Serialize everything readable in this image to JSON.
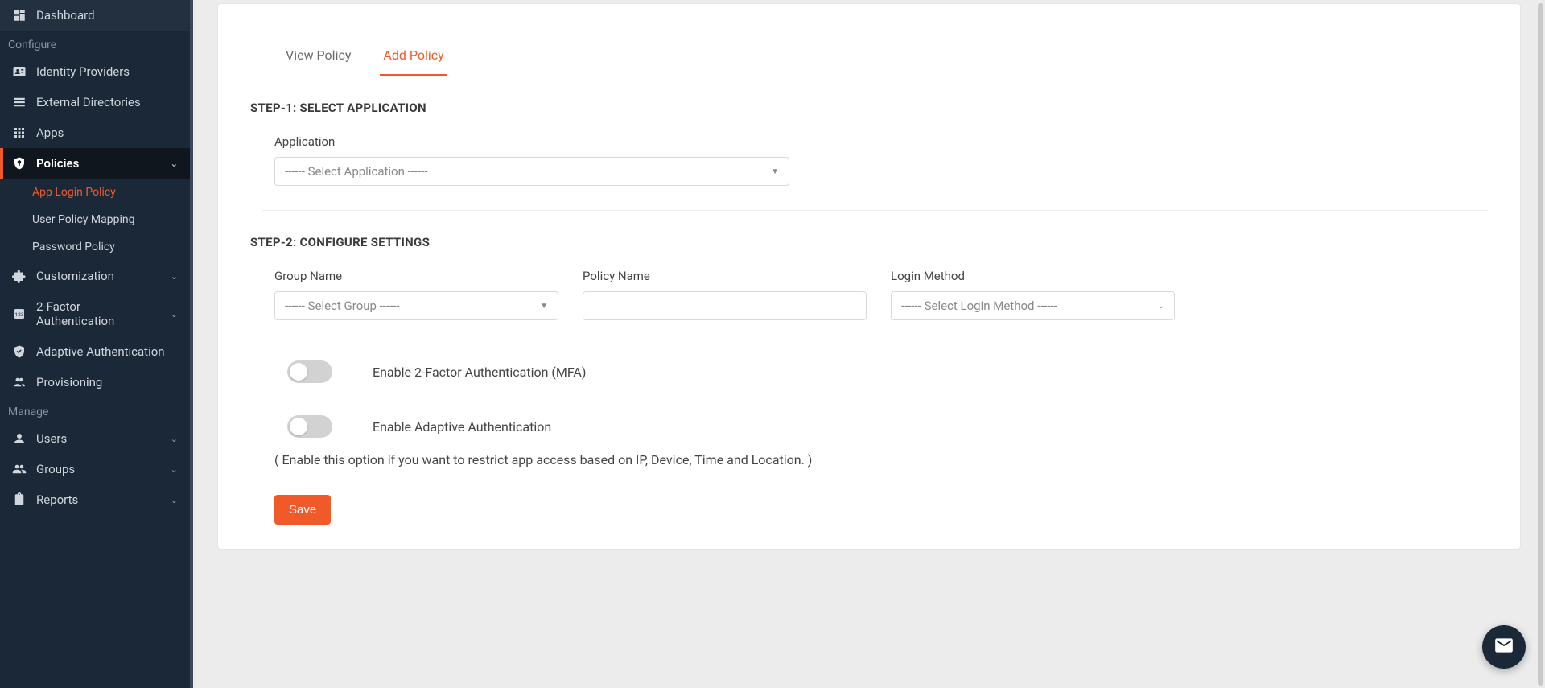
{
  "sidebar": {
    "sections": {
      "configure": "Configure",
      "manage": "Manage"
    },
    "items": {
      "dashboard": "Dashboard",
      "idp": "Identity Providers",
      "ext_dir": "External Directories",
      "apps": "Apps",
      "policies": "Policies",
      "customization": "Customization",
      "two_factor": "2-Factor Authentication",
      "adaptive": "Adaptive Authentication",
      "provisioning": "Provisioning",
      "users": "Users",
      "groups": "Groups",
      "reports": "Reports"
    },
    "sub": {
      "app_login_policy": "App Login Policy",
      "user_policy_mapping": "User Policy Mapping",
      "password_policy": "Password Policy"
    }
  },
  "tabs": {
    "view": "View Policy",
    "add": "Add Policy"
  },
  "step1": {
    "title": "STEP-1: SELECT APPLICATION",
    "app_label": "Application",
    "app_placeholder": "------ Select Application ------"
  },
  "step2": {
    "title": "STEP-2: CONFIGURE SETTINGS",
    "group_label": "Group Name",
    "group_placeholder": "------ Select Group ------",
    "policy_label": "Policy Name",
    "login_label": "Login Method",
    "login_placeholder": "------ Select Login Method ------",
    "toggle_mfa": "Enable 2-Factor Authentication (MFA)",
    "toggle_adaptive": "Enable Adaptive Authentication",
    "adaptive_desc": "( Enable this option if you want to restrict app access based on IP, Device, Time and Location. )"
  },
  "buttons": {
    "save": "Save"
  }
}
